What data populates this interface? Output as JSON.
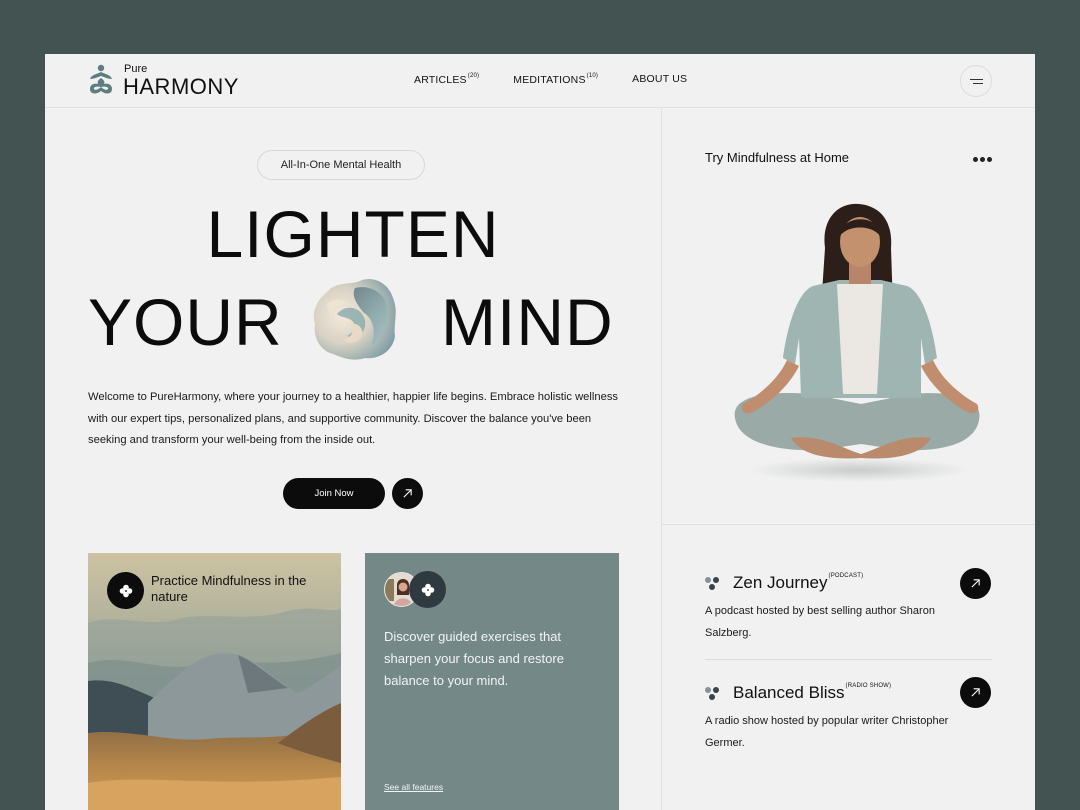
{
  "header": {
    "logo_small": "Pure",
    "logo_big": "HARMONY",
    "nav": [
      {
        "label": "ARTICLES",
        "count": "(20)"
      },
      {
        "label": "MEDITATIONS",
        "count": "(10)"
      },
      {
        "label": "ABOUT US",
        "count": ""
      }
    ],
    "menu_icon": "hamburger-icon"
  },
  "hero": {
    "pill": "All-In-One Mental Health",
    "line1": "LIGHTEN",
    "line2_left": "YOUR",
    "line2_right": "MIND",
    "description": "Welcome to PureHarmony, where your journey to a healthier, happier life begins. Embrace holistic wellness with our expert tips, personalized plans, and supportive community. Discover the balance you've been seeking and transform your well-being from the inside out.",
    "join_label": "Join Now",
    "arrow_icon": "arrow-up-right-icon"
  },
  "cards": {
    "nature": {
      "title": "Practice Mindfulness in the nature",
      "icon": "clover-icon"
    },
    "features": {
      "text": "Discover guided exercises that sharpen your focus and restore balance to your mind.",
      "link": "See all features",
      "icon": "clover-icon"
    }
  },
  "sidebar": {
    "title": "Try Mindfulness at Home",
    "more_icon": "more-dots-icon",
    "shows": [
      {
        "title": "Zen Journey",
        "tag": "(PODCAST)",
        "description": "A podcast hosted by best selling author Sharon Salzberg."
      },
      {
        "title": "Balanced Bliss",
        "tag": "(RADIO SHOW)",
        "description": "A radio show hosted by popular writer Christopher Germer."
      }
    ]
  },
  "colors": {
    "frame_bg": "#435352",
    "page_bg": "#f1f1f1",
    "accent_teal": "#738887",
    "logo_teal": "#5e7d80",
    "dark": "#0c0c0c"
  }
}
